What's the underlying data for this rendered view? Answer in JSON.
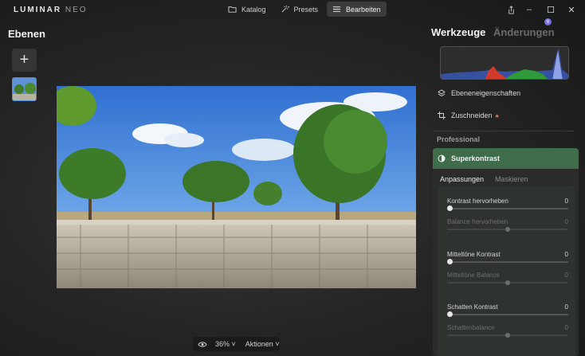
{
  "app": {
    "logo_main": "LUMINAR",
    "logo_sub": "NEO"
  },
  "topnav": [
    {
      "label": "Katalog",
      "icon": "folder-icon",
      "active": false
    },
    {
      "label": "Presets",
      "icon": "sparkle-icon",
      "active": false
    },
    {
      "label": "Bearbeiten",
      "icon": "sliders-icon",
      "active": true
    }
  ],
  "window": {
    "notification_count": "6"
  },
  "layers": {
    "title": "Ebenen",
    "add_symbol": "+"
  },
  "canvas": {
    "zoom": "36%",
    "actions_label": "Aktionen"
  },
  "panel": {
    "tab_tools": "Werkzeuge",
    "tab_changes": "Änderungen",
    "layer_props": "Ebeneneigenschaften",
    "crop": "Zuschneiden",
    "section": "Professional",
    "tool": {
      "name": "Superkontrast",
      "subtab_adjust": "Anpassungen",
      "subtab_mask": "Maskieren",
      "sliders": [
        {
          "label": "Kontrast hervorheben",
          "value": "0",
          "level": 0,
          "enabled": true
        },
        {
          "label": "Balance hervorheben",
          "value": "0",
          "level": 0.5,
          "enabled": false
        },
        {
          "label": "Mitteltöne Kontrast",
          "value": "0",
          "level": 0,
          "enabled": true
        },
        {
          "label": "Mitteltöne Balance",
          "value": "0",
          "level": 0.5,
          "enabled": false
        },
        {
          "label": "Schatten Kontrast",
          "value": "0",
          "level": 0,
          "enabled": true
        },
        {
          "label": "Schattenbalance",
          "value": "0",
          "level": 0.5,
          "enabled": false
        }
      ]
    }
  },
  "colors": {
    "accent_green": "#3f6c49",
    "selection_blue": "#4a8fd8",
    "badge_purple": "#7b6bf0"
  }
}
